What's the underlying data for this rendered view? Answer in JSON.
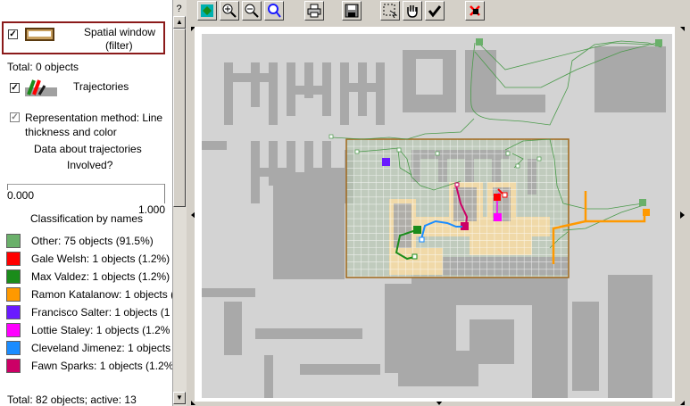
{
  "toolbar": {
    "help_label": "?",
    "tools": [
      "zoom-to-fit-icon",
      "zoom-in-icon",
      "zoom-out-icon",
      "pan-zoom-icon",
      "print-icon",
      "save-icon",
      "select-rect-icon",
      "hand-icon",
      "check-icon",
      "no-edit-icon"
    ]
  },
  "legend": {
    "spatial_window": {
      "checked": true,
      "label_line1": "Spatial window",
      "label_line2": "(filter)"
    },
    "total_objects": "Total: 0 objects",
    "trajectories": {
      "checked": true,
      "label": "Trajectories"
    },
    "representation": {
      "checked": true,
      "line1": "Representation method: Line",
      "line2": "thickness and color"
    },
    "data_about": "Data about trajectories",
    "involved": "Involved?",
    "slider_min": "0.000",
    "slider_max": "1.000",
    "classification_title": "Classification by names",
    "classes": [
      {
        "label": "Other: 75 objects (91.5%)",
        "color": "#6ab06a"
      },
      {
        "label": "Gale Welsh: 1 objects (1.2%)",
        "color": "#ff0000"
      },
      {
        "label": "Max Valdez: 1 objects (1.2%)",
        "color": "#1a8c1a"
      },
      {
        "label": "Ramon Katalanow: 1 objects (1",
        "color": "#ff9900"
      },
      {
        "label": "Francisco Salter: 1 objects (1",
        "color": "#6a1aff"
      },
      {
        "label": "Lottie Staley: 1 objects (1.2%",
        "color": "#ff00ff"
      },
      {
        "label": "Cleveland Jimenez: 1 objects",
        "color": "#1a8cff"
      },
      {
        "label": "Fawn Sparks: 1 objects (1.2%",
        "color": "#cc0066"
      }
    ],
    "footer": "Total: 82 objects; active: 13"
  },
  "colors": {
    "spatial_window_border": "#8b1a1a",
    "filter_rect": "#a0671a",
    "building_wall": "#a9a9a9",
    "floor": "#d3d3d3",
    "room_highlight": "#f0d9a8"
  }
}
